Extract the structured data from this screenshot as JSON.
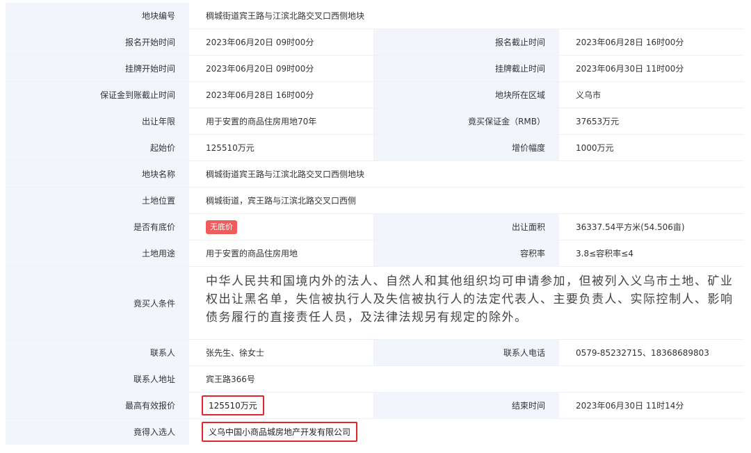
{
  "rows": {
    "plot_no": {
      "label": "地块编号",
      "value": "稠城街道宾王路与江滨北路交叉口西侧地块"
    },
    "signup_start": {
      "label": "报名开始时间",
      "value": "2023年06月20日 09时00分"
    },
    "signup_end": {
      "label": "报名截止时间",
      "value": "2023年06月28日 16时00分"
    },
    "listing_start": {
      "label": "挂牌开始时间",
      "value": "2023年06月20日 09时00分"
    },
    "listing_end": {
      "label": "挂牌截止时间",
      "value": "2023年06月30日 11时00分"
    },
    "deposit_deadline": {
      "label": "保证金到账截止时间",
      "value": "2023年06月28日 16时00分"
    },
    "region": {
      "label": "地块所在区域",
      "value": "义乌市"
    },
    "term": {
      "label": "出让年限",
      "value": "用于安置的商品住房用地70年"
    },
    "deposit": {
      "label": "竟买保证金（RMB）",
      "value": "37653万元"
    },
    "start_price": {
      "label": "起始价",
      "value": "125510万元"
    },
    "increment": {
      "label": "增价幅度",
      "value": "1000万元"
    },
    "plot_name": {
      "label": "地块名称",
      "value": "稠城街道宾王路与江滨北路交叉口西侧地块"
    },
    "location": {
      "label": "土地位置",
      "value": "稠城街道，宾王路与江滨北路交叉口西侧"
    },
    "reserve": {
      "label": "是否有底价",
      "value": "无底价"
    },
    "area": {
      "label": "出让面积",
      "value": "36337.54平方米(54.506亩)"
    },
    "usage": {
      "label": "土地用途",
      "value": "用于安置的商品住房用地"
    },
    "far": {
      "label": "容积率",
      "value": "3.8≤容积率≤4"
    },
    "conditions": {
      "label": "竟买人条件",
      "value": "中华人民共和国境内外的法人、自然人和其他组织均可申请参加，但被列入义乌市土地、矿业权出让黑名单，失信被执行人及失信被执行人的法定代表人、主要负责人、实际控制人、影响债务履行的直接责任人员，及法律法规另有规定的除外。"
    },
    "contact": {
      "label": "联系人",
      "value": "张先生、徐女士"
    },
    "phone": {
      "label": "联系人电话",
      "value": "0579-85232715、18368689803"
    },
    "address": {
      "label": "联系人地址",
      "value": "宾王路366号"
    },
    "top_bid": {
      "label": "最高有效报价",
      "value": "125510万元"
    },
    "end_time": {
      "label": "结束时间",
      "value": "2023年06月30日 11时14分"
    },
    "winner": {
      "label": "竟得入选人",
      "value": "义乌中国小商品城房地产开发有限公司"
    }
  },
  "colors": {
    "label_bg": "#f2f6fc",
    "highlight_border": "#e0262b",
    "tag_bg": "#f05b5b"
  }
}
